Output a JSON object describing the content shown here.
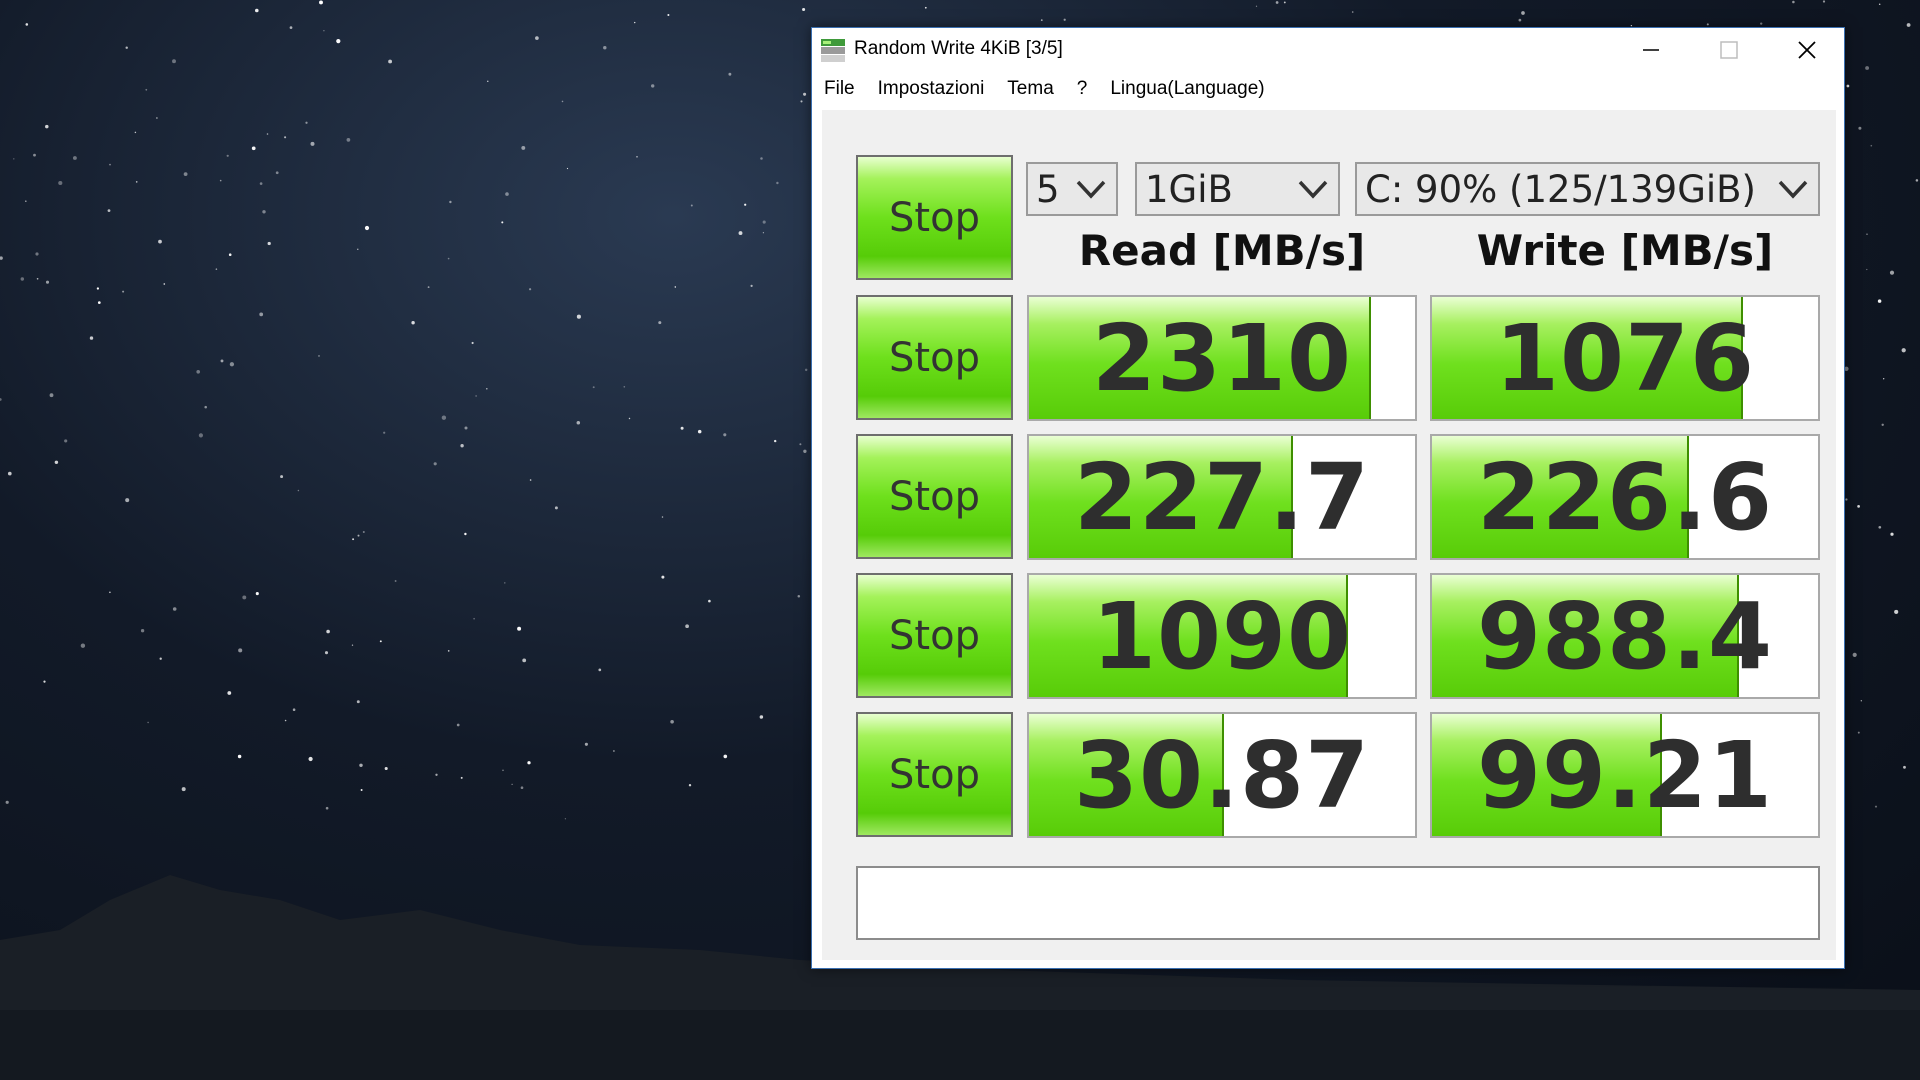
{
  "window": {
    "title": "Random Write 4KiB [3/5]"
  },
  "menu": [
    "File",
    "Impostazioni",
    "Tema",
    "?",
    "Lingua(Language)"
  ],
  "controls": {
    "all_button_label": "Stop",
    "count_value": "5",
    "size_value": "1GiB",
    "drive_value": "C: 90% (125/139GiB)"
  },
  "headers": {
    "read": "Read [MB/s]",
    "write": "Write [MB/s]"
  },
  "rows": [
    {
      "button": "Stop",
      "read": "2310",
      "write": "1076",
      "read_fill": 0.88,
      "write_fill": 0.8
    },
    {
      "button": "Stop",
      "read": "227.7",
      "write": "226.6",
      "read_fill": 0.68,
      "write_fill": 0.66
    },
    {
      "button": "Stop",
      "read": "1090",
      "write": "988.4",
      "read_fill": 0.82,
      "write_fill": 0.79
    },
    {
      "button": "Stop",
      "read": "30.87",
      "write": "99.21",
      "read_fill": 0.5,
      "write_fill": 0.59
    }
  ],
  "comment": "",
  "colors": {
    "accent_green": "#6ee01c",
    "window_border": "#3a6fb0"
  }
}
